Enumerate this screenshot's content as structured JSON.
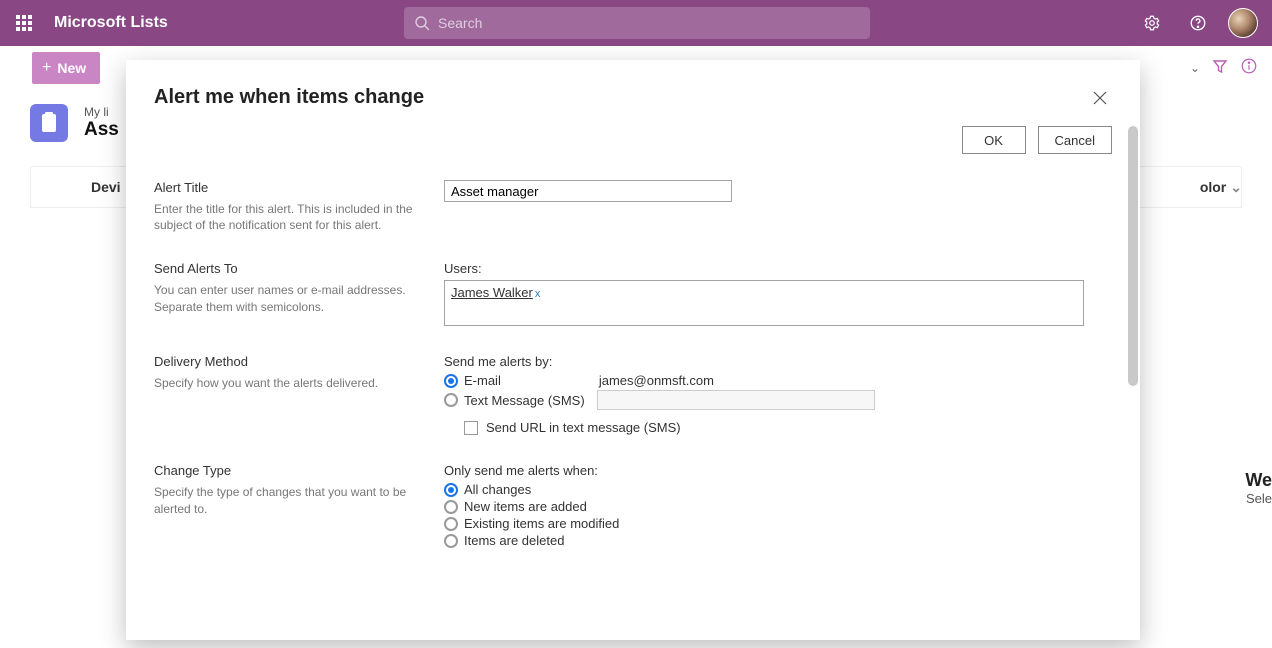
{
  "suite": {
    "brand": "Microsoft Lists",
    "search_placeholder": "Search"
  },
  "cmd": {
    "new_label": "New",
    "right_col_label": "olor"
  },
  "page": {
    "breadcrumb": "My li",
    "list_title": "Ass",
    "col1": "Devi",
    "right_pane_title": "We",
    "right_pane_sub": "Sele"
  },
  "modal": {
    "title": "Alert me when items change",
    "ok": "OK",
    "cancel": "Cancel",
    "sections": {
      "alert_title": {
        "title": "Alert Title",
        "desc": "Enter the title for this alert. This is included in the subject of the notification sent for this alert.",
        "value": "Asset manager"
      },
      "send_to": {
        "title": "Send Alerts To",
        "desc": "You can enter user names or e-mail addresses. Separate them with semicolons.",
        "field_label": "Users:",
        "user": "James Walker",
        "remove_glyph": "x"
      },
      "delivery": {
        "title": "Delivery Method",
        "desc": "Specify how you want the alerts delivered.",
        "legend": "Send me alerts by:",
        "opt_email": "E-mail",
        "email_value": "james@onmsft.com",
        "opt_sms": "Text Message (SMS)",
        "chk_label": "Send URL in text message (SMS)"
      },
      "change_type": {
        "title": "Change Type",
        "desc": "Specify the type of changes that you want to be alerted to.",
        "legend": "Only send me alerts when:",
        "opts": {
          "all": "All changes",
          "new": "New items are added",
          "mod": "Existing items are modified",
          "del": "Items are deleted"
        }
      }
    }
  }
}
